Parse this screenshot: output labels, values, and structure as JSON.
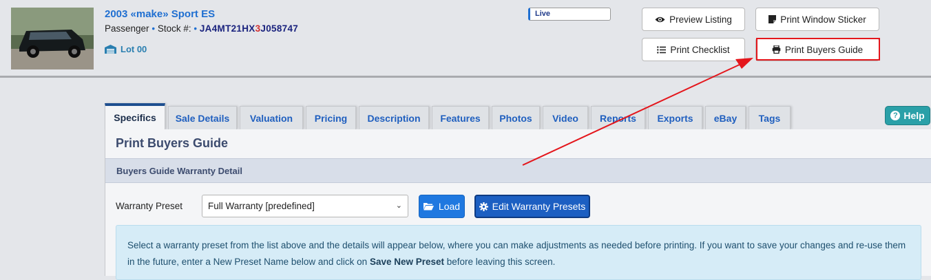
{
  "vehicle": {
    "title": "2003 «make» Sport ES",
    "type": "Passenger",
    "stock_label": "Stock #:",
    "vin_part1": "JA4MT21HX",
    "vin_highlight": "3",
    "vin_part2": "J058747",
    "lot": "Lot 00",
    "status": "Live"
  },
  "actions": {
    "preview": "Preview Listing",
    "sticker": "Print Window Sticker",
    "checklist": "Print Checklist",
    "buyers_guide": "Print Buyers Guide"
  },
  "tabs": [
    {
      "label": "Specifics",
      "active": true
    },
    {
      "label": "Sale Details"
    },
    {
      "label": "Valuation"
    },
    {
      "label": "Pricing"
    },
    {
      "label": "Description"
    },
    {
      "label": "Features"
    },
    {
      "label": "Photos"
    },
    {
      "label": "Video"
    },
    {
      "label": "Reports"
    },
    {
      "label": "Exports"
    },
    {
      "label": "eBay"
    },
    {
      "label": "Tags"
    }
  ],
  "help": "Help",
  "panel": {
    "title": "Print Buyers Guide",
    "section": "Buyers Guide Warranty Detail",
    "preset_label": "Warranty Preset",
    "preset_value": "Full Warranty [predefined]",
    "load_button": "Load",
    "edit_button": "Edit Warranty Presets",
    "info_text_1": "Select a warranty preset from the list above and the details will appear below, where you can make adjustments as needed before printing. If you want to save your changes and re-use them in the future, enter a New Preset Name below and click on ",
    "info_bold": "Save New Preset",
    "info_text_2": " before leaving this screen."
  },
  "colors": {
    "accent": "#1f6fd1",
    "highlight_red": "#e4161c",
    "help_teal": "#2aa0a8"
  }
}
